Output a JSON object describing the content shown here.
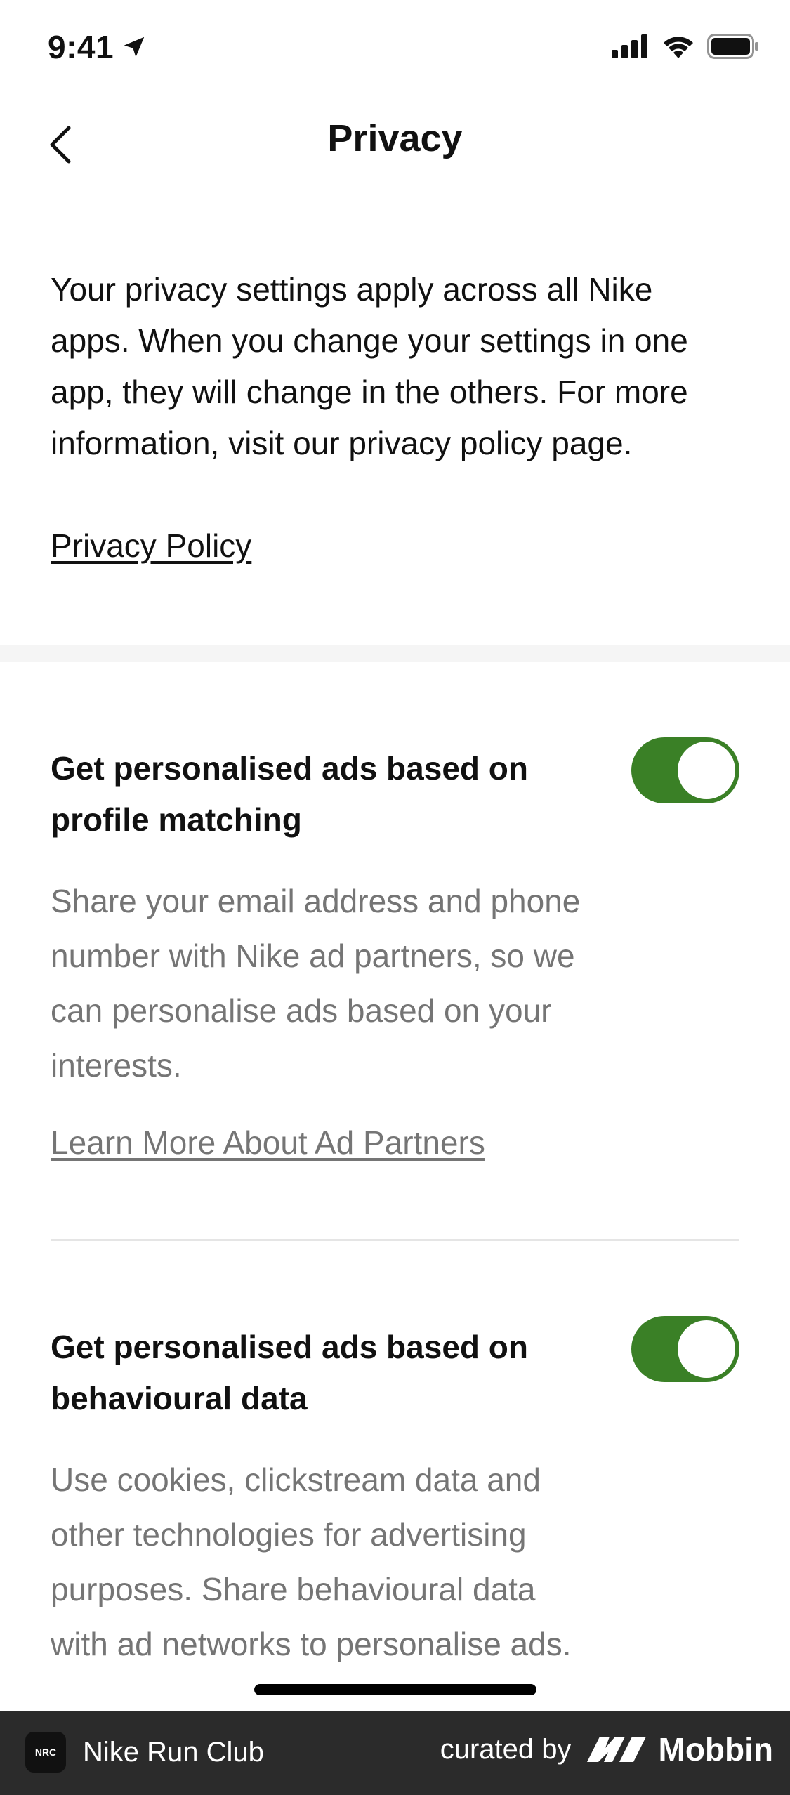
{
  "status_bar": {
    "time": "9:41"
  },
  "nav": {
    "title": "Privacy"
  },
  "intro": {
    "text": "Your privacy settings apply across all Nike apps. When you change your settings in one app, they will change in the others. For more information, visit our privacy policy page.",
    "link": "Privacy Policy"
  },
  "settings": [
    {
      "title": "Get personalised ads based on profile matching",
      "description": "Share your email address and phone number with Nike ad partners, so we can personalise ads based on your interests.",
      "link": "Learn More About Ad Partners",
      "enabled": true
    },
    {
      "title": "Get personalised ads based on behavioural data",
      "description": "Use cookies, clickstream data and other technologies for advertising purposes. Share behavioural data with ad networks to personalise ads.",
      "enabled": true
    }
  ],
  "banner": {
    "app_icon_text": "NRC",
    "app_name": "Nike Run Club",
    "curated_by": "curated by",
    "brand": "Mobbin"
  },
  "colors": {
    "toggle_on": "#3a8026",
    "secondary_text": "#757575"
  }
}
